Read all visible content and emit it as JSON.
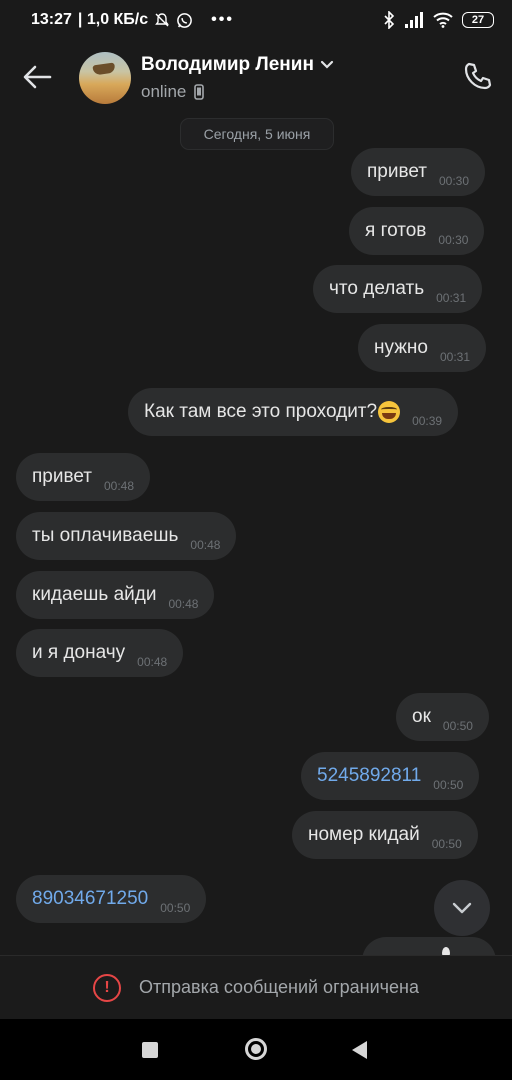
{
  "status_bar": {
    "time": "13:27",
    "speed": "| 1,0 КБ/с",
    "battery": "27",
    "icons": [
      "mute-icon",
      "whatsapp-icon",
      "more-icon",
      "bluetooth-icon",
      "signal-icon",
      "wifi-icon",
      "battery-icon"
    ]
  },
  "header": {
    "contact_name": "Володимир Ленин",
    "presence": "online"
  },
  "date_label": "Сегодня, 5 июня",
  "messages": [
    {
      "text": "привет",
      "time": "00:30",
      "side": "out"
    },
    {
      "text": "я готов",
      "time": "00:30",
      "side": "out"
    },
    {
      "text": "что делать",
      "time": "00:31",
      "side": "out"
    },
    {
      "text": "нужно",
      "time": "00:31",
      "side": "out"
    },
    {
      "text": "Как там все это проходит?",
      "time": "00:39",
      "side": "out",
      "emoji": "rofl"
    },
    {
      "text": "привет",
      "time": "00:48",
      "side": "in"
    },
    {
      "text": "ты оплачиваешь",
      "time": "00:48",
      "side": "in"
    },
    {
      "text": "кидаешь айди",
      "time": "00:48",
      "side": "in"
    },
    {
      "text": "и я доначу",
      "time": "00:48",
      "side": "in"
    },
    {
      "text": "ок",
      "time": "00:50",
      "side": "out"
    },
    {
      "text": "5245892811",
      "time": "00:50",
      "side": "out",
      "link": true
    },
    {
      "text": "номер кидай",
      "time": "00:50",
      "side": "out"
    },
    {
      "text": "89034671250",
      "time": "00:50",
      "side": "in",
      "link": true
    }
  ],
  "restriction_text": "Отправка сообщений ограничена",
  "colors": {
    "background": "#1a1a1a",
    "bubble": "#2c2d2e",
    "link": "#71aaeb",
    "warning": "#e64646"
  }
}
